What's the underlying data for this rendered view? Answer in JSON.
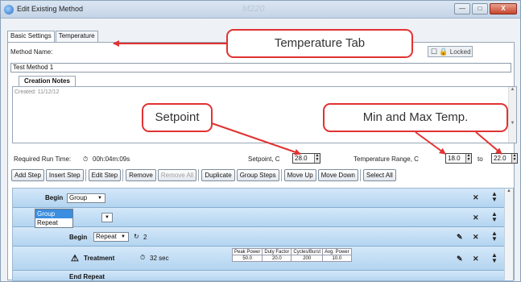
{
  "window": {
    "title": "Edit Existing Method",
    "faded_title": "M220",
    "controls": [
      "—",
      "□",
      "X"
    ]
  },
  "tabs": [
    {
      "label": "Basic Settings",
      "active": true
    },
    {
      "label": "Temperature",
      "active": false
    }
  ],
  "method": {
    "name_label": "Method Name:",
    "name_value": "Test Method 1",
    "lock_label": "Locked"
  },
  "notes": {
    "tab_label": "Creation Notes",
    "created_text": "Created: 11/12/12"
  },
  "run": {
    "required_label": "Required Run Time:",
    "required_value": "00h:04m:09s",
    "setpoint_label": "Setpoint, C",
    "setpoint_value": "28.0",
    "temp_range_label": "Temperature Range, C",
    "temp_min": "18.0",
    "to_label": "to",
    "temp_max": "22.0"
  },
  "toolbar": [
    "Add Step",
    "Insert Step",
    "Edit Step",
    "Remove",
    "Remove All",
    "Duplicate",
    "Group Steps",
    "Move Up",
    "Move Down",
    "Select All"
  ],
  "steps": {
    "row1_label": "Begin",
    "row1_select": "Group",
    "dropdown_options": [
      "Group",
      "Repeat"
    ],
    "row2_label": "Be",
    "row3_label": "Begin",
    "row3_select": "Repeat",
    "row3_count": "2",
    "treatment_label": "Treatment",
    "treatment_time": "32 sec",
    "power_headers": [
      "Peak Power",
      "Duty Factor",
      "Cycles/Burst",
      "Avg. Power"
    ],
    "power_values": [
      "50.0",
      "20.0",
      "200",
      "10.0"
    ],
    "end_label": "End Repeat"
  },
  "annotations": {
    "temperature_tab": "Temperature Tab",
    "setpoint": "Setpoint",
    "min_max": "Min and Max Temp."
  },
  "colors": {
    "accent": "#e23232",
    "row_blue": "#b3d4f0",
    "selection": "#3b8ee0"
  }
}
